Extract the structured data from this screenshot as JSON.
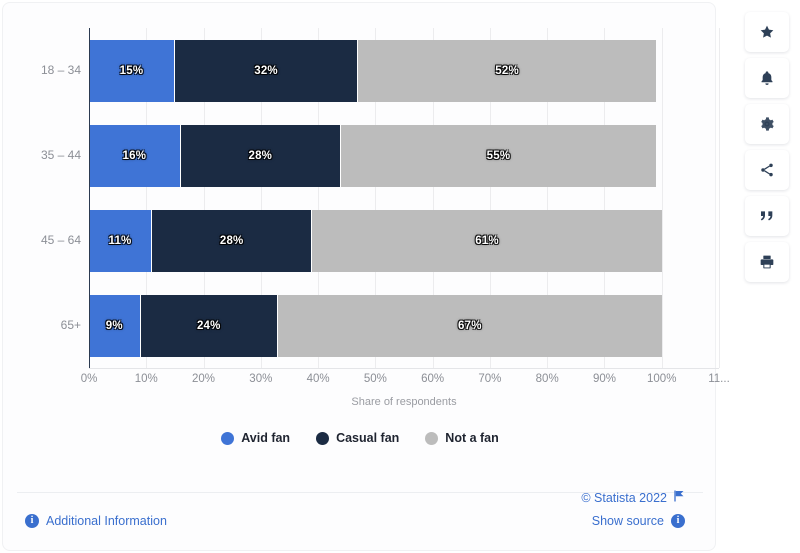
{
  "chart_data": {
    "type": "bar",
    "orientation": "horizontal",
    "stacked": true,
    "title": "",
    "xlabel": "Share of respondents",
    "ylabel": "",
    "xlim": [
      0,
      110
    ],
    "xticks": [
      "0%",
      "10%",
      "20%",
      "30%",
      "40%",
      "50%",
      "60%",
      "70%",
      "80%",
      "90%",
      "100%",
      "11..."
    ],
    "xtick_values": [
      0,
      10,
      20,
      30,
      40,
      50,
      60,
      70,
      80,
      90,
      100,
      110
    ],
    "grid": true,
    "legend_position": "bottom",
    "categories": [
      "18 – 34",
      "35 – 44",
      "45 – 64",
      "65+"
    ],
    "series": [
      {
        "name": "Avid fan",
        "color": "#3f74d6",
        "values": [
          15,
          16,
          11,
          9
        ],
        "labels": [
          "15%",
          "16%",
          "11%",
          "9%"
        ]
      },
      {
        "name": "Casual fan",
        "color": "#1b2b43",
        "values": [
          32,
          28,
          28,
          24
        ],
        "labels": [
          "32%",
          "28%",
          "28%",
          "24%"
        ]
      },
      {
        "name": "Not a fan",
        "color": "#bcbcbc",
        "values": [
          52,
          55,
          61,
          67
        ],
        "labels": [
          "52%",
          "55%",
          "61%",
          "67%"
        ]
      }
    ]
  },
  "footer": {
    "additional_information": "Additional Information",
    "copyright": "© Statista 2022",
    "show_source": "Show source",
    "info_glyph": "i"
  },
  "toolbar": {
    "items": [
      {
        "name": "favorite-star-icon",
        "title": "Favorite"
      },
      {
        "name": "notification-bell-icon",
        "title": "Notifications"
      },
      {
        "name": "settings-gear-icon",
        "title": "Settings"
      },
      {
        "name": "share-icon",
        "title": "Share"
      },
      {
        "name": "citation-quote-icon",
        "title": "Citation"
      },
      {
        "name": "print-icon",
        "title": "Print"
      }
    ]
  }
}
